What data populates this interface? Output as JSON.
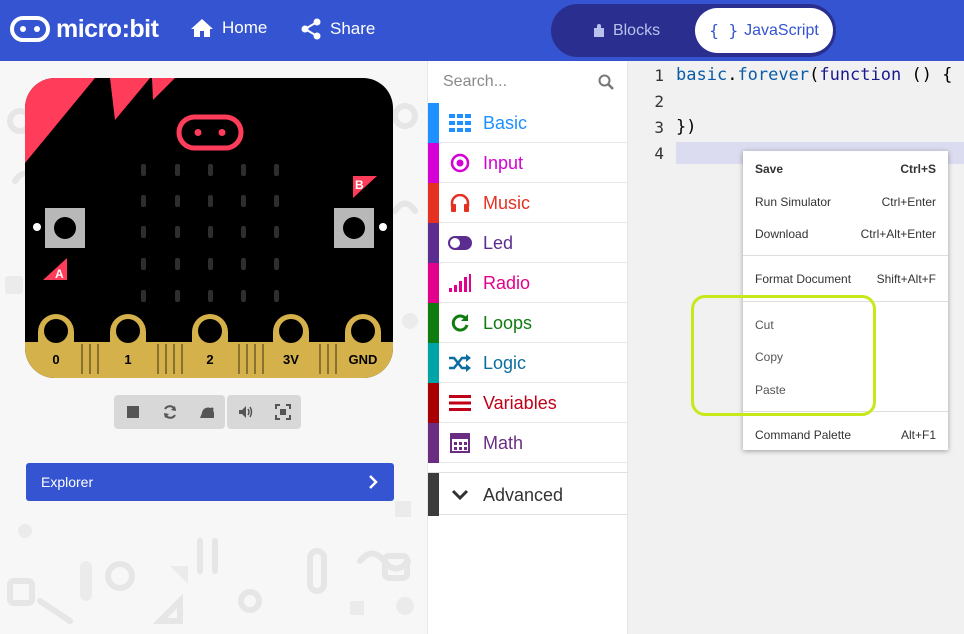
{
  "header": {
    "brand": "micro:bit",
    "home_label": "Home",
    "share_label": "Share",
    "blocks_label": "Blocks",
    "js_braces": "{ }",
    "js_label": "JavaScript"
  },
  "simulator": {
    "board_labels": {
      "btn_a": "A",
      "btn_b": "B"
    },
    "pins": [
      "0",
      "1",
      "2",
      "3V",
      "GND"
    ],
    "explorer_label": "Explorer"
  },
  "toolbox": {
    "search_placeholder": "Search...",
    "categories": [
      {
        "label": "Basic",
        "color": "#1e90ff",
        "icon": "grid-icon"
      },
      {
        "label": "Input",
        "color": "#d400d4",
        "icon": "target-icon"
      },
      {
        "label": "Music",
        "color": "#e63022",
        "icon": "headphones-icon"
      },
      {
        "label": "Led",
        "color": "#5c2d91",
        "icon": "toggle-icon"
      },
      {
        "label": "Radio",
        "color": "#e3008c",
        "icon": "signal-icon"
      },
      {
        "label": "Loops",
        "color": "#107c10",
        "icon": "refresh-icon"
      },
      {
        "label": "Logic",
        "color": "#00a4a6",
        "icon": "shuffle-icon"
      },
      {
        "label": "Variables",
        "color": "#dc143c",
        "icon": "lines-icon"
      },
      {
        "label": "Math",
        "color": "#9400d3",
        "icon": "calculator-icon"
      }
    ],
    "advanced_label": "Advanced"
  },
  "editor": {
    "line_numbers": [
      "1",
      "2",
      "3",
      "4"
    ],
    "line1_obj": "basic",
    "line1_dot": ".",
    "line1_method": "forever",
    "line1_open": "(",
    "line1_kw": "function",
    "line1_rest": " () {",
    "line3": "})"
  },
  "context_menu": {
    "items": [
      {
        "label": "Save",
        "shortcut": "Ctrl+S"
      },
      {
        "label": "Run Simulator",
        "shortcut": "Ctrl+Enter"
      },
      {
        "label": "Download",
        "shortcut": "Ctrl+Alt+Enter"
      },
      {
        "label": "Format Document",
        "shortcut": "Shift+Alt+F"
      },
      {
        "label": "Cut",
        "shortcut": ""
      },
      {
        "label": "Copy",
        "shortcut": ""
      },
      {
        "label": "Paste",
        "shortcut": ""
      },
      {
        "label": "Command Palette",
        "shortcut": "Alt+F1"
      }
    ]
  },
  "colors": {
    "header": "#3454d1",
    "board_red": "#ff3d5a",
    "pin_gold": "#d4b14a",
    "highlight": "#c8e81a"
  }
}
